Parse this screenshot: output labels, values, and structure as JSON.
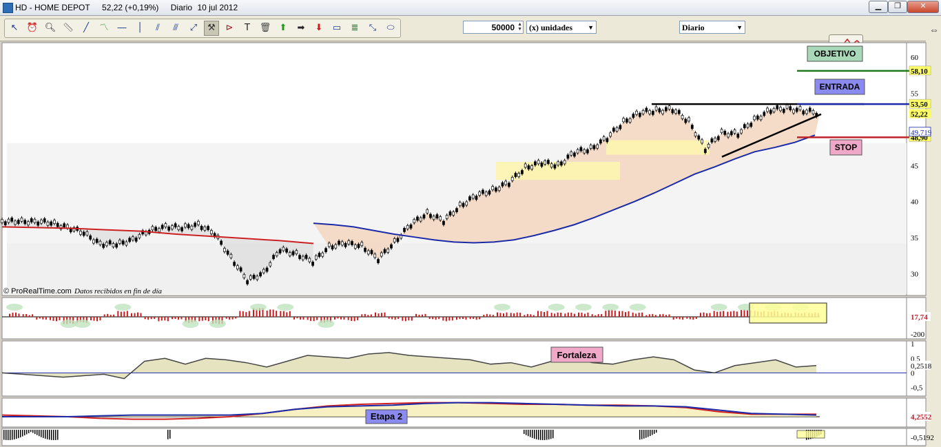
{
  "window": {
    "symbol": "HD - HOME DEPOT",
    "last": "52,22 (+0,19%)",
    "period": "Diario",
    "date": "10 jul 2012",
    "buttons": {
      "minimize": "▁",
      "maximize": "❐",
      "close": "✕"
    }
  },
  "toolbar": {
    "tools": [
      "pointer-icon",
      "alarm-icon",
      "zoom-icon",
      "ruler-icon",
      "line-icon",
      "price-line-icon",
      "horizontal-line-icon",
      "vertical-line-icon",
      "fibonacci-icon",
      "channel-icon",
      "arrow-line-icon",
      "hammer-icon",
      "triangle-icon",
      "text-icon",
      "trash-icon",
      "up-arrow-icon",
      "right-arrow-icon",
      "down-arrow-icon",
      "rectangle-icon",
      "fibonacci-fan-icon",
      "ray-icon",
      "ellipse-icon"
    ],
    "quantity": "50000",
    "units_label": "(x) unidades",
    "period_select": "Diario"
  },
  "chart_data": [
    {
      "type": "line",
      "panel": "price",
      "description_text": "© ProRealTime.com",
      "source_note": "Datos recibidos en fin de día",
      "y_ticks": [
        60,
        55,
        45,
        40,
        35,
        30
      ],
      "ylim": [
        27,
        62
      ],
      "series": [
        {
          "name": "",
          "values": [
            37.3,
            37.2,
            37.3,
            37.0,
            36.5,
            35.6,
            34.2,
            34.0,
            34.8,
            35.9,
            36.6,
            36.3,
            36.9,
            35.5,
            32.3,
            29.0,
            30.2,
            33.3,
            32.8,
            31.6,
            33.8,
            34.2,
            33.9,
            32.0,
            34.4,
            36.8,
            38.4,
            37.3,
            39.4,
            40.8,
            41.6,
            42.6,
            44.7,
            45.4,
            45.0,
            46.8,
            47.3,
            48.8,
            51.0,
            52.3,
            52.6,
            52.8,
            51.1,
            47.3,
            49.5,
            49.4,
            51.3,
            52.7,
            52.9,
            52.6,
            52.2
          ]
        },
        {
          "name": "",
          "color": "#1a2aa8",
          "values": [
            37.0,
            36.8,
            36.5,
            36.0,
            35.5,
            35.1,
            34.7,
            34.4,
            34.3,
            34.4,
            34.7,
            35.3,
            36.0,
            36.8,
            37.8,
            38.9,
            40.0,
            41.2,
            42.5,
            43.8,
            44.8,
            45.9,
            46.9,
            47.5,
            48.2,
            49.2
          ]
        },
        {
          "name": "",
          "color": "#cc2020",
          "values": [
            36.5,
            36.4,
            36.3,
            36.1,
            35.9,
            35.5,
            35.2,
            34.9,
            34.6,
            34.2
          ]
        }
      ],
      "levels": [
        {
          "label": "OBJETIVO",
          "value": 58.1,
          "tag": "58,10",
          "color": "#1c7a1c",
          "label_bg": "#a8d8b8"
        },
        {
          "label": "ENTRADA",
          "value": 53.5,
          "tag": "53,50",
          "color": "#1a2aa8",
          "label_bg": "#8a8af0"
        },
        {
          "label": "STOP",
          "value": 48.9,
          "tag": "48,90",
          "color": "#c0202a",
          "label_bg": "#f0a8c8"
        }
      ],
      "last_tag": "52,22",
      "ma_tag": "49,719"
    },
    {
      "type": "bar",
      "panel": "histogram",
      "y_ticks": [
        "-200"
      ],
      "last_tag": "17,74",
      "values": [
        2,
        1,
        -1,
        -2,
        -4,
        -3,
        -2,
        1,
        3,
        2,
        -1,
        -2,
        -1,
        -3,
        -2,
        -4,
        -1,
        3,
        5,
        4,
        3,
        -1,
        -2,
        -3,
        -1,
        -2,
        1,
        2,
        -1,
        -2,
        1,
        -1,
        -2,
        -1,
        -1,
        1,
        2,
        2,
        1,
        3,
        2,
        2,
        2,
        1,
        4,
        3,
        2,
        1,
        1,
        -1,
        -1,
        2,
        3,
        3,
        4,
        3,
        3,
        2,
        2,
        2
      ]
    },
    {
      "type": "line",
      "panel": "oscillator",
      "title": "Fortaleza",
      "y_ticks": [
        "1",
        "0,5",
        "0",
        "-0,5"
      ],
      "ylim": [
        -0.8,
        1.1
      ],
      "last_tag": "0,2518",
      "values": [
        0.0,
        -0.05,
        -0.1,
        -0.15,
        -0.1,
        -0.05,
        -0.2,
        0.4,
        0.5,
        0.3,
        0.5,
        0.45,
        0.35,
        0.2,
        0.4,
        0.6,
        0.55,
        0.5,
        0.65,
        0.7,
        0.6,
        0.55,
        0.5,
        0.45,
        0.3,
        0.35,
        0.2,
        0.4,
        0.5,
        0.35,
        0.3,
        0.45,
        0.55,
        0.45,
        0.1,
        0.0,
        0.25,
        0.35,
        0.45,
        0.2,
        0.25
      ]
    },
    {
      "type": "line",
      "panel": "stage",
      "title": "Etapa 2",
      "last_tag": "4,2552",
      "series": [
        {
          "name": "",
          "values": [
            0.2,
            0.1,
            0.0,
            -0.2,
            -0.3,
            -0.3,
            -0.2,
            0.0,
            0.4,
            0.9,
            1.3,
            1.5,
            1.6,
            1.7,
            1.7,
            1.6,
            1.5,
            1.5,
            1.4,
            1.4,
            1.3,
            1.1,
            0.6,
            0.3,
            0.3,
            0.3
          ]
        },
        {
          "name": "",
          "values": [
            0.0,
            0.0,
            0.0,
            0.1,
            0.2,
            0.2,
            0.2,
            0.2,
            0.4,
            0.9,
            1.2,
            1.3,
            1.4,
            1.6,
            1.7,
            1.7,
            1.6,
            1.5,
            1.4,
            1.3,
            1.3,
            1.2,
            0.8,
            0.4,
            0.3,
            0.2
          ]
        }
      ]
    },
    {
      "type": "bar",
      "panel": "volume-bottom",
      "last_tag": "-0,5192"
    }
  ]
}
